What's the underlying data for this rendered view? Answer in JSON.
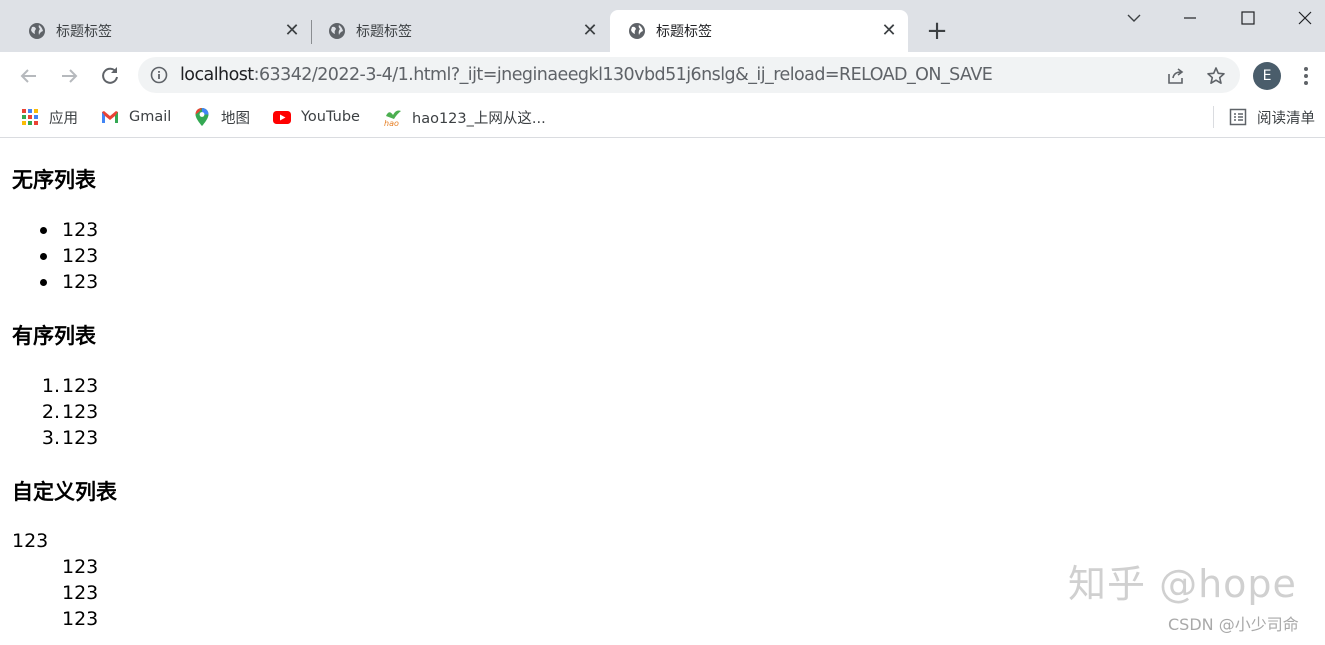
{
  "tabs": [
    {
      "title": "标题标签",
      "active": false
    },
    {
      "title": "标题标签",
      "active": false
    },
    {
      "title": "标题标签",
      "active": true
    }
  ],
  "address_bar": {
    "url_host": "localhost",
    "url_rest": ":63342/2022-3-4/1.html?_ijt=jneginaeegkl130vbd51j6nslg&_ij_reload=RELOAD_ON_SAVE"
  },
  "profile": {
    "initial": "E",
    "color": "#4a5d6b"
  },
  "bookmarks": [
    {
      "label": "应用",
      "icon": "apps-grid-icon"
    },
    {
      "label": "Gmail",
      "icon": "gmail-icon"
    },
    {
      "label": "地图",
      "icon": "maps-pin-icon"
    },
    {
      "label": "YouTube",
      "icon": "youtube-icon"
    },
    {
      "label": "hao123_上网从这...",
      "icon": "hao123-icon"
    }
  ],
  "reading_list": {
    "label": "阅读清单",
    "icon": "reading-list-icon"
  },
  "page": {
    "unordered": {
      "heading": "无序列表",
      "items": [
        "123",
        "123",
        "123"
      ]
    },
    "ordered": {
      "heading": "有序列表",
      "markers": [
        "1.",
        "2.",
        "3."
      ],
      "items": [
        "123",
        "123",
        "123"
      ]
    },
    "definition": {
      "heading": "自定义列表",
      "term": "123",
      "descriptions": [
        "123",
        "123",
        "123"
      ]
    }
  },
  "watermark": {
    "zhihu": "知乎 @hope",
    "csdn": "CSDN @小少司命"
  }
}
